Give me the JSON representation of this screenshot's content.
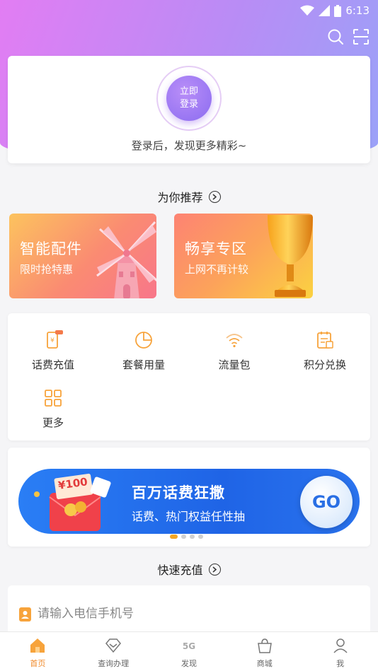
{
  "status_bar": {
    "time": "6:13"
  },
  "login": {
    "button_line1": "立即",
    "button_line2": "登录",
    "hint": "登录后，发现更多精彩~"
  },
  "recommend": {
    "title": "为你推荐"
  },
  "promos": [
    {
      "title": "智能配件",
      "subtitle": "限时抢特惠"
    },
    {
      "title": "畅享专区",
      "subtitle": "上网不再计较"
    }
  ],
  "menu": {
    "items": [
      {
        "label": "话费充值",
        "icon": "phone-recharge-icon"
      },
      {
        "label": "套餐用量",
        "icon": "pie-chart-icon"
      },
      {
        "label": "流量包",
        "icon": "wifi-icon"
      },
      {
        "label": "积分兑换",
        "icon": "points-exchange-icon"
      },
      {
        "label": "更多",
        "icon": "grid-icon"
      }
    ]
  },
  "banner": {
    "title": "百万话费狂撒",
    "subtitle": "话费、热门权益任性抽",
    "go_label": "GO",
    "ticket_label": "¥100",
    "page_count": 4,
    "active_page": 1
  },
  "quick_recharge": {
    "title": "快速充值",
    "placeholder": "请输入电信手机号"
  },
  "tabbar": {
    "tabs": [
      {
        "label": "首页",
        "icon": "home-icon",
        "active": true
      },
      {
        "label": "查询办理",
        "icon": "diamond-icon",
        "active": false
      },
      {
        "label": "发现",
        "icon": "5g-icon",
        "active": false
      },
      {
        "label": "商城",
        "icon": "shopping-bag-icon",
        "active": false
      },
      {
        "label": "我",
        "icon": "user-icon",
        "active": false
      }
    ]
  },
  "colors": {
    "accent": "#f08a2a",
    "hero_gradient_start": "#e27df3",
    "hero_gradient_end": "#9aa2f8",
    "banner_blue": "#1f64e6"
  }
}
